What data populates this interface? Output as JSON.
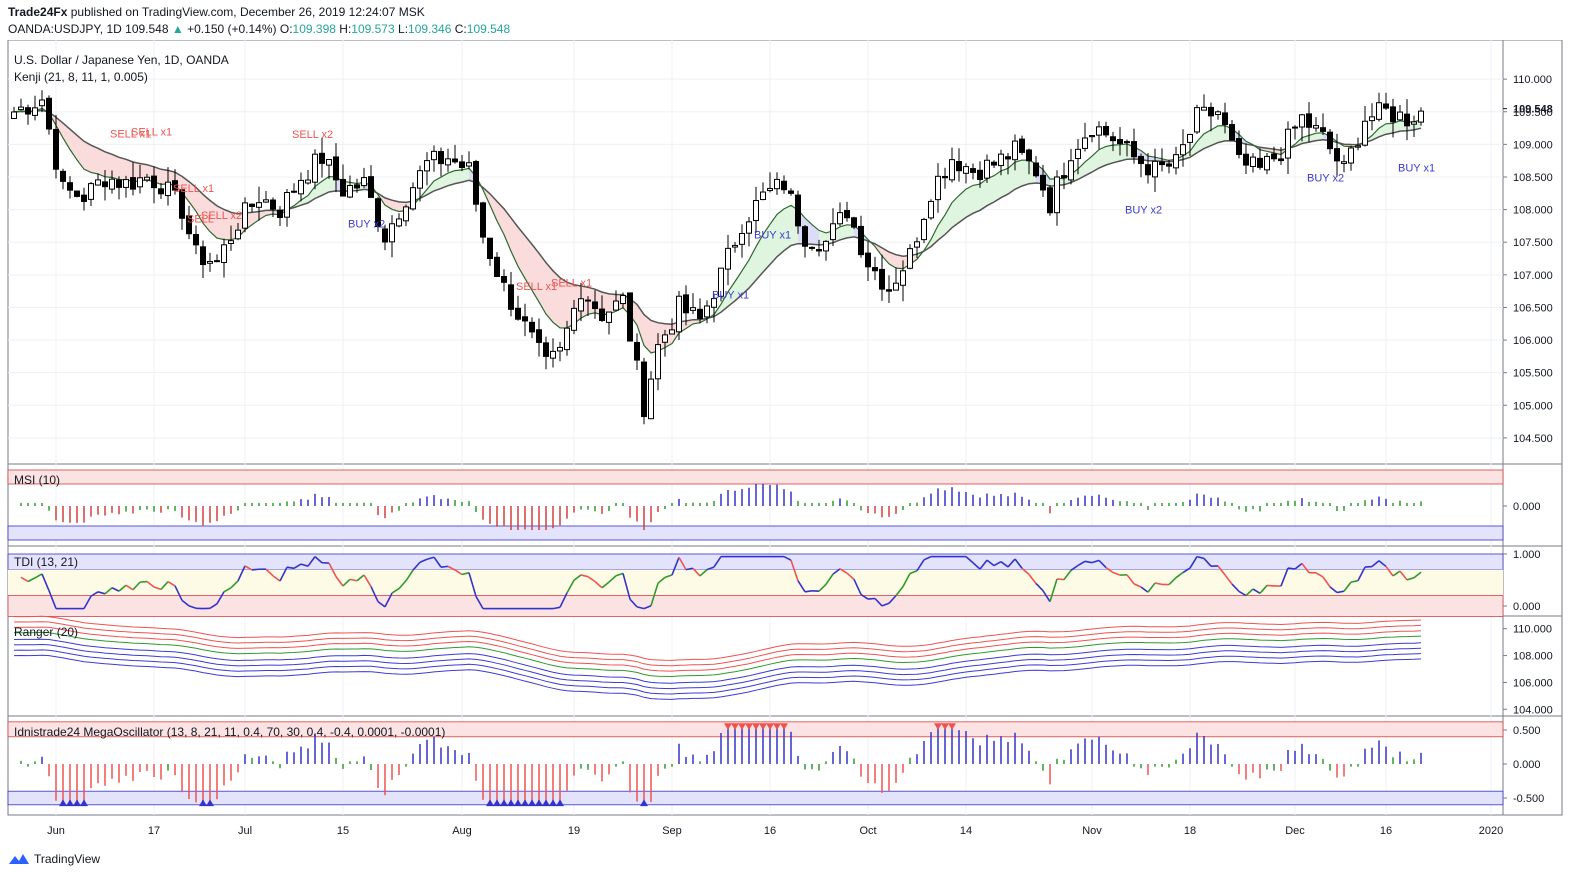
{
  "header": {
    "publisher": "Trade24Fx",
    "published_text": "published on TradingView.com, December 26, 2019 12:24:07 MSK",
    "symbol": "OANDA:USDJPY, 1D",
    "last": "109.548",
    "change": "+0.150 (+0.14%)",
    "o_label": "O:",
    "o": "109.398",
    "h_label": "H:",
    "h": "109.573",
    "l_label": "L:",
    "l": "109.346",
    "c_label": "C:",
    "c": "109.548"
  },
  "footer": {
    "brand": "TradingView"
  },
  "colors": {
    "up": "#ffffff",
    "down": "#000000",
    "sell": "#ef5350",
    "buy": "#3b3bd6",
    "msi_pos": "#3333cc",
    "msi_neg": "#d33f3f",
    "msi_neutral": "#2e9a2e"
  },
  "chart_data": [
    {
      "type": "candlestick",
      "title": "U.S. Dollar / Japanese Yen, 1D, OANDA",
      "indicator_label": "Kenji (21, 8, 11, 1, 0.005)",
      "y_ticks": [
        110.0,
        109.5,
        109.0,
        108.5,
        108.0,
        107.5,
        107.0,
        106.5,
        106.0,
        105.5,
        105.0,
        104.5
      ],
      "ylim": [
        104.1,
        110.6
      ],
      "x_tick_labels": [
        "Jun",
        "17",
        "Jul",
        "15",
        "Aug",
        "19",
        "Sep",
        "16",
        "Oct",
        "14",
        "Nov",
        "18",
        "Dec",
        "16",
        "2020"
      ],
      "current_price_label": "109.548",
      "close_path": [
        [
          0,
          109.5
        ],
        [
          4,
          109.7
        ],
        [
          7,
          108.3
        ],
        [
          10,
          108.2
        ],
        [
          13,
          108.5
        ],
        [
          16,
          108.4
        ],
        [
          19,
          108.5
        ],
        [
          21,
          108.4
        ],
        [
          24,
          108.0
        ],
        [
          26,
          107.3
        ],
        [
          29,
          107.2
        ],
        [
          32,
          107.8
        ],
        [
          35,
          108.2
        ],
        [
          38,
          108.0
        ],
        [
          41,
          108.5
        ],
        [
          44,
          108.8
        ],
        [
          47,
          108.3
        ],
        [
          50,
          108.4
        ],
        [
          53,
          107.6
        ],
        [
          56,
          108.2
        ],
        [
          59,
          108.7
        ],
        [
          62,
          108.8
        ],
        [
          65,
          108.6
        ],
        [
          67,
          107.6
        ],
        [
          70,
          106.8
        ],
        [
          73,
          106.2
        ],
        [
          76,
          105.6
        ],
        [
          78,
          105.8
        ],
        [
          81,
          106.8
        ],
        [
          84,
          106.4
        ],
        [
          87,
          106.6
        ],
        [
          90,
          105.0
        ],
        [
          92,
          105.9
        ],
        [
          95,
          106.5
        ],
        [
          98,
          106.3
        ],
        [
          101,
          107.0
        ],
        [
          104,
          107.8
        ],
        [
          107,
          108.2
        ],
        [
          110,
          108.4
        ],
        [
          113,
          107.6
        ],
        [
          116,
          107.5
        ],
        [
          119,
          108.0
        ],
        [
          122,
          107.2
        ],
        [
          125,
          106.8
        ],
        [
          128,
          107.3
        ],
        [
          131,
          108.3
        ],
        [
          134,
          108.8
        ],
        [
          137,
          108.6
        ],
        [
          140,
          108.7
        ],
        [
          143,
          108.9
        ],
        [
          146,
          108.6
        ],
        [
          148,
          108.1
        ],
        [
          151,
          108.9
        ],
        [
          154,
          109.3
        ],
        [
          157,
          109.1
        ],
        [
          160,
          108.8
        ],
        [
          163,
          108.6
        ],
        [
          166,
          108.7
        ],
        [
          169,
          109.4
        ],
        [
          172,
          109.5
        ],
        [
          175,
          108.7
        ],
        [
          178,
          108.6
        ],
        [
          181,
          108.9
        ],
        [
          184,
          109.4
        ],
        [
          187,
          109.1
        ],
        [
          190,
          108.6
        ],
        [
          193,
          109.4
        ],
        [
          196,
          109.5
        ],
        [
          199,
          109.4
        ],
        [
          201,
          109.5
        ]
      ],
      "signals": [
        {
          "label": "SELL x1",
          "type": "sell",
          "index": 16
        },
        {
          "label": "SELL x1",
          "type": "sell",
          "index": 19
        },
        {
          "label": "SELL x1",
          "type": "sell",
          "index": 25
        },
        {
          "label": "SELL x2",
          "type": "sell",
          "index": 29
        },
        {
          "label": "SELL",
          "type": "sell",
          "index": 27
        },
        {
          "label": "SELL x2",
          "type": "sell",
          "index": 42
        },
        {
          "label": "BUY x2",
          "type": "buy",
          "index": 50
        },
        {
          "label": "SELL x1",
          "type": "sell",
          "index": 74
        },
        {
          "label": "SELL x1",
          "type": "sell",
          "index": 79
        },
        {
          "label": "BUY x1",
          "type": "buy",
          "index": 102
        },
        {
          "label": "BUY x1",
          "type": "buy",
          "index": 108
        },
        {
          "label": "BUY x2",
          "type": "buy",
          "index": 161
        },
        {
          "label": "BUY x2",
          "type": "buy",
          "index": 187
        },
        {
          "label": "BUY x1",
          "type": "buy",
          "index": 200
        }
      ]
    },
    {
      "type": "bar",
      "title": "MSI (10)",
      "y_ticks": [
        0.0
      ],
      "y_tick_labels": [
        "0.000"
      ]
    },
    {
      "type": "line",
      "title": "TDI (13, 21)",
      "y_ticks": [
        1.0,
        0.0
      ],
      "y_tick_labels": [
        "1.000",
        "0.000"
      ]
    },
    {
      "type": "line",
      "title": "Ranger (20)",
      "y_ticks": [
        110.0,
        108.0,
        106.0,
        104.0
      ],
      "y_tick_labels": [
        "110.000",
        "108.000",
        "106.000",
        "104.000"
      ]
    },
    {
      "type": "bar",
      "title": "Idnistrade24 MegaOscillator (13, 8, 21, 11, 0.4, 70, 30, 0.4, -0.4, 0.0001, -0.0001)",
      "y_ticks": [
        0.5,
        0.0,
        -0.5
      ],
      "y_tick_labels": [
        "0.500",
        "0.000",
        "-0.500"
      ]
    }
  ]
}
